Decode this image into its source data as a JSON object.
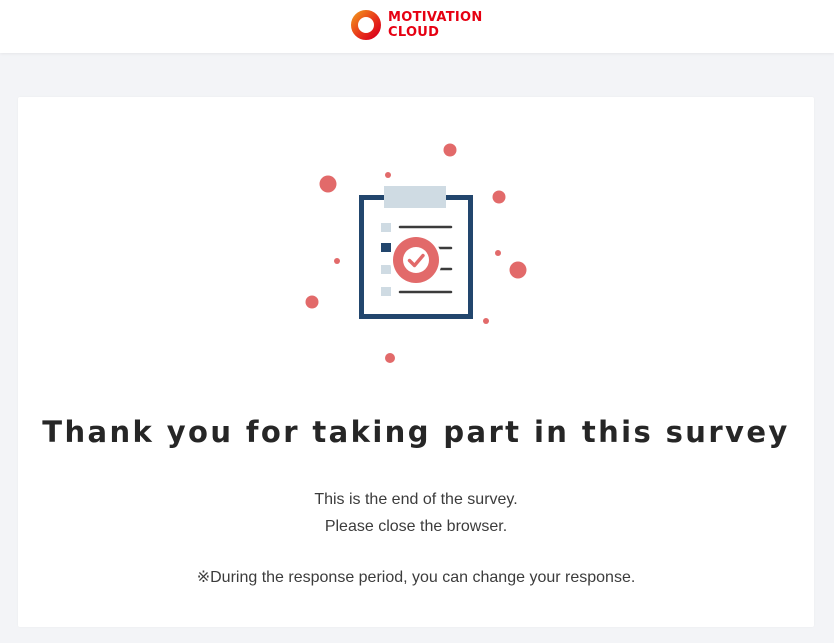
{
  "header": {
    "brand_line1": "MOTIVATION",
    "brand_line2": "CLOUD",
    "brand_color": "#e60012"
  },
  "illustration": {
    "icon": "survey-complete-clipboard-icon",
    "primary_color": "#22466d",
    "accent_color": "#e26a6a",
    "clip_color": "#cfdbe3"
  },
  "main": {
    "title": "Thank you for taking part in this survey",
    "line1": "This is the end of the survey.",
    "line2": "Please close the browser.",
    "note": "※During the response period, you can change your response."
  }
}
